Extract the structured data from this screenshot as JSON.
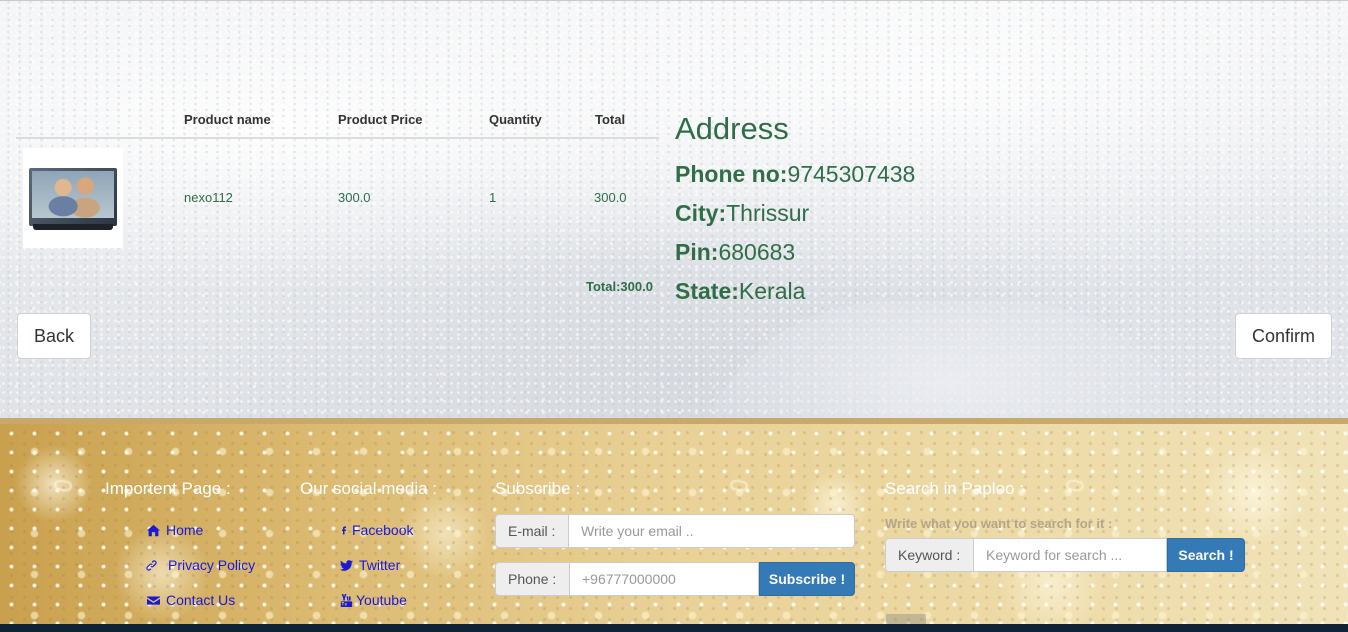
{
  "table": {
    "headers": [
      "Product name",
      "Product Price",
      "Quantity",
      "Total"
    ],
    "rows": [
      {
        "name": "nexo112",
        "price": "300.0",
        "quantity": "1",
        "total": "300.0"
      }
    ],
    "grand_total": "Total:300.0"
  },
  "address": {
    "title": "Address",
    "phone_label": "Phone no:",
    "phone": "9745307438",
    "city_label": "City:",
    "city": "Thrissur",
    "pin_label": "Pin:",
    "pin": "680683",
    "state_label": "State:",
    "state": "Kerala"
  },
  "buttons": {
    "back": "Back",
    "confirm": "Confirm"
  },
  "footer": {
    "important": {
      "heading": "Importent Page :",
      "links": [
        {
          "label": "Home",
          "icon": "home-icon"
        },
        {
          "label": "Privacy Policy",
          "icon": "link-icon"
        },
        {
          "label": "Contact Us",
          "icon": "envelope-icon"
        }
      ]
    },
    "social": {
      "heading": "Our social media :",
      "links": [
        {
          "label": "Facebook",
          "icon": "facebook-icon"
        },
        {
          "label": "Twitter",
          "icon": "twitter-icon"
        },
        {
          "label": "Youtube",
          "icon": "youtube-icon"
        }
      ]
    },
    "subscribe": {
      "heading": "Subscribe :",
      "email_label": "E-mail :",
      "email_placeholder": "Write your email ..",
      "phone_label": "Phone :",
      "phone_placeholder": "+96777000000",
      "button": "Subscribe !"
    },
    "search": {
      "heading": "Search in Paploo :",
      "hint": "Write what you want to search for it :",
      "keyword_label": "Keyword :",
      "keyword_placeholder": "Keyword for search ...",
      "button": "Search !"
    }
  },
  "colors": {
    "text_green": "#2f6e47",
    "link_blue": "#1a1ad6",
    "button_blue": "#337ab7",
    "footer_gold": "#dcbb73",
    "bottom_bar": "#0f2236"
  }
}
